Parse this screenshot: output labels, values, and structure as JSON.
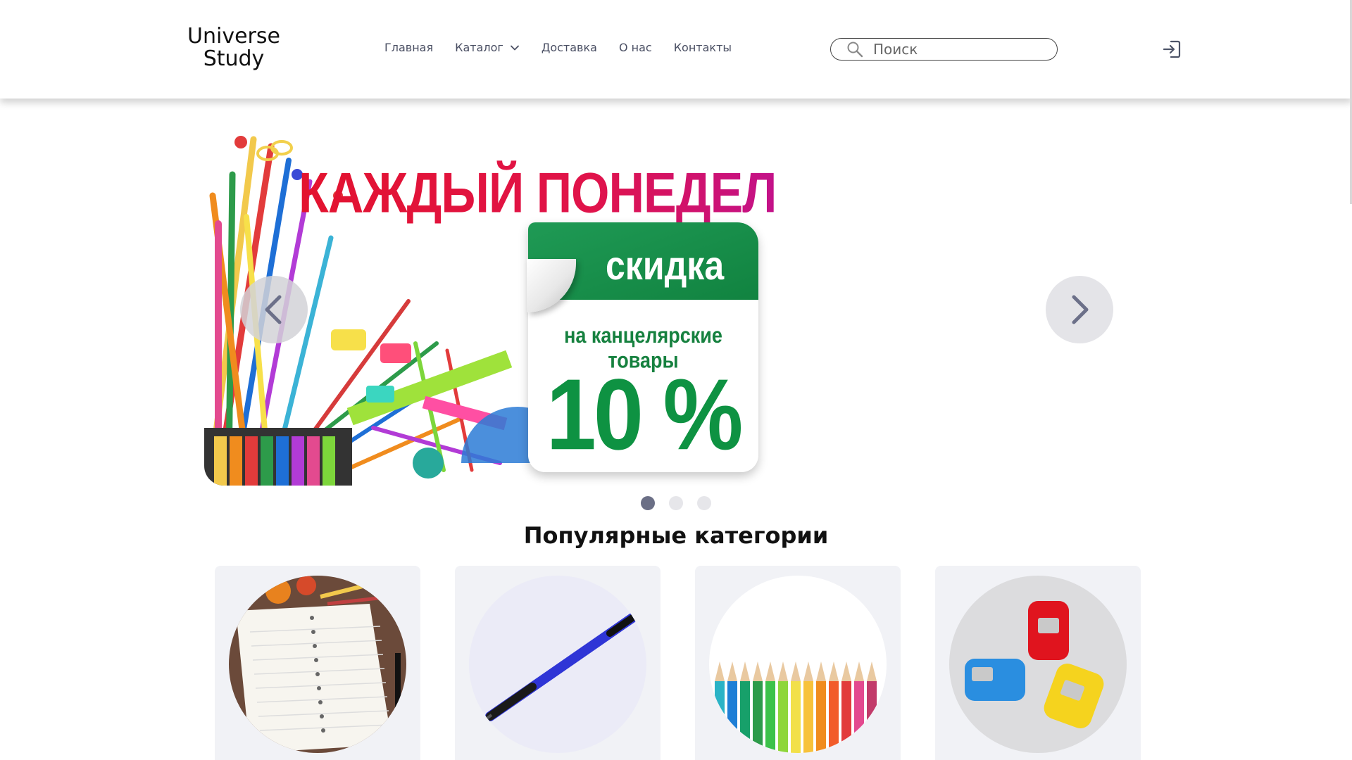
{
  "header": {
    "logo_line1": "Universe",
    "logo_line2": "Study",
    "nav": [
      {
        "label": "Главная"
      },
      {
        "label": "Каталог",
        "has_dropdown": true
      },
      {
        "label": "Доставка"
      },
      {
        "label": "О нас"
      },
      {
        "label": "Контакты"
      }
    ],
    "search": {
      "placeholder": "Поиск",
      "value": ""
    },
    "icons": {
      "search": "search-icon",
      "login": "login-icon",
      "dropdown": "chevron-down-icon"
    }
  },
  "slider": {
    "headline": "КАЖДЫЙ ПОНЕДЕЛЬНИК",
    "sticker_title": "скидка",
    "sticker_subtitle": "на канцелярские товары",
    "discount": "10 %",
    "slides_count": 3,
    "active_slide": 1,
    "colors": {
      "headline": "#e3132e",
      "sticker": "#118340"
    }
  },
  "categories": {
    "title": "Популярные категории",
    "items": [
      {
        "image": "notebook-image"
      },
      {
        "image": "pen-image"
      },
      {
        "image": "colored-pencils-image"
      },
      {
        "image": "sharpeners-image"
      }
    ]
  }
}
